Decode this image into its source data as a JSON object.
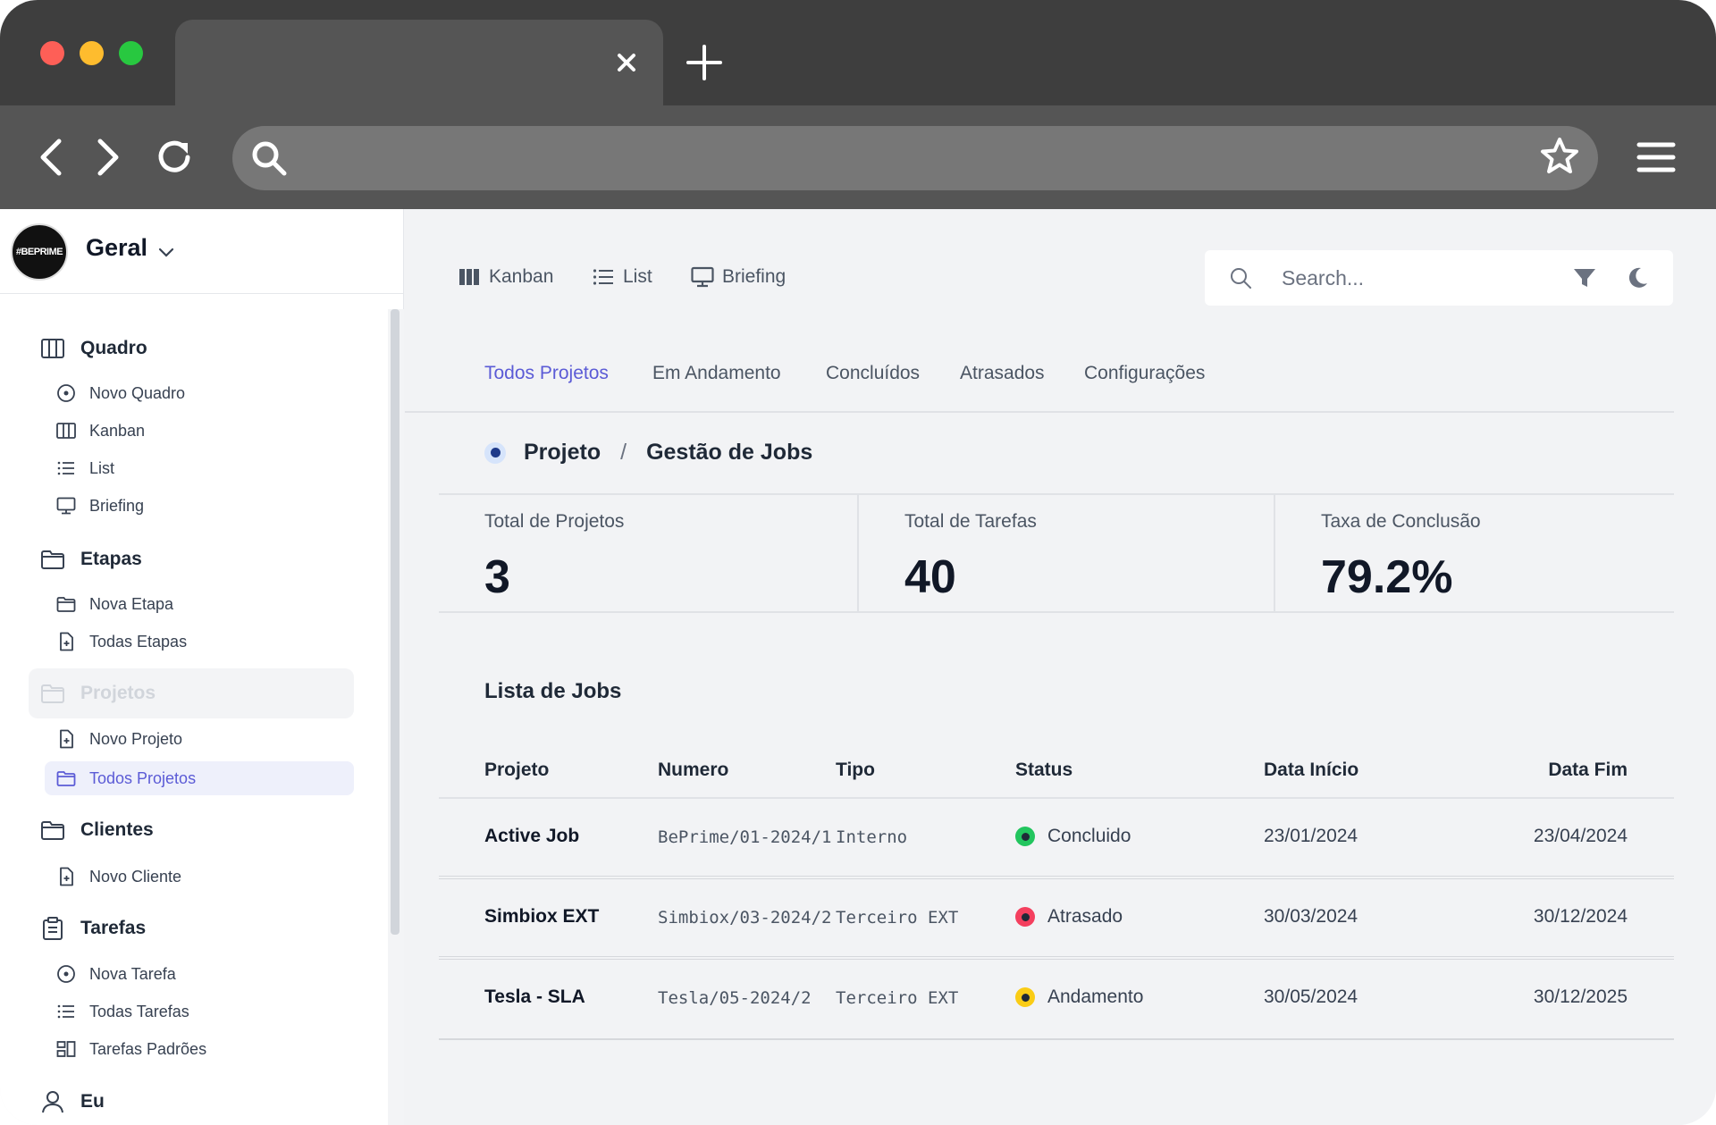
{
  "browser": {
    "tab_title": "",
    "url": ""
  },
  "sidebar": {
    "workspace": "Geral",
    "logo_text": "#BEPRIME",
    "sections": [
      {
        "label": "Quadro",
        "items": [
          "Novo Quadro",
          "Kanban",
          "List",
          "Briefing"
        ]
      },
      {
        "label": "Etapas",
        "items": [
          "Nova Etapa",
          "Todas Etapas"
        ]
      },
      {
        "label": "Projetos",
        "items": [
          "Novo Projeto",
          "Todos Projetos"
        ]
      },
      {
        "label": "Clientes",
        "items": [
          "Novo Cliente"
        ]
      },
      {
        "label": "Tarefas",
        "items": [
          "Nova Tarefa",
          "Todas Tarefas",
          "Tarefas Padrões"
        ]
      },
      {
        "label": "Eu",
        "items": []
      }
    ],
    "active_item": "Todos Projetos"
  },
  "toolbar": {
    "views": [
      "Kanban",
      "List",
      "Briefing"
    ],
    "search_placeholder": "Search..."
  },
  "tabs": [
    "Todos Projetos",
    "Em Andamento",
    "Concluídos",
    "Atrasados",
    "Configurações"
  ],
  "active_tab": "Todos Projetos",
  "breadcrumb": {
    "root": "Projeto",
    "separator": "/",
    "current": "Gestão de Jobs"
  },
  "stats": [
    {
      "label": "Total de Projetos",
      "value": "3"
    },
    {
      "label": "Total de Tarefas",
      "value": "40"
    },
    {
      "label": "Taxa de Conclusão",
      "value": "79.2%"
    }
  ],
  "jobs": {
    "title": "Lista de Jobs",
    "columns": [
      "Projeto",
      "Numero",
      "Tipo",
      "Status",
      "Data Início",
      "Data Fim"
    ],
    "rows": [
      {
        "projeto": "Active Job",
        "numero": "BePrime/01-2024/1",
        "tipo": "Interno",
        "status": "Concluido",
        "status_color": "#22c55e",
        "inicio": "23/01/2024",
        "fim": "23/04/2024"
      },
      {
        "projeto": "Simbiox EXT",
        "numero": "Simbiox/03-2024/2",
        "tipo": "Terceiro EXT",
        "status": "Atrasado",
        "status_color": "#f43f5e",
        "inicio": "30/03/2024",
        "fim": "30/12/2024"
      },
      {
        "projeto": "Tesla - SLA",
        "numero": "Tesla/05-2024/2",
        "tipo": "Terceiro EXT",
        "status": "Andamento",
        "status_color": "#facc15",
        "inicio": "30/05/2024",
        "fim": "30/12/2025"
      }
    ]
  },
  "colors": {
    "accent": "#5b5bd6",
    "chrome_dark": "#3e3e3e",
    "chrome_mid": "#555555",
    "main_bg": "#f2f3f5"
  }
}
